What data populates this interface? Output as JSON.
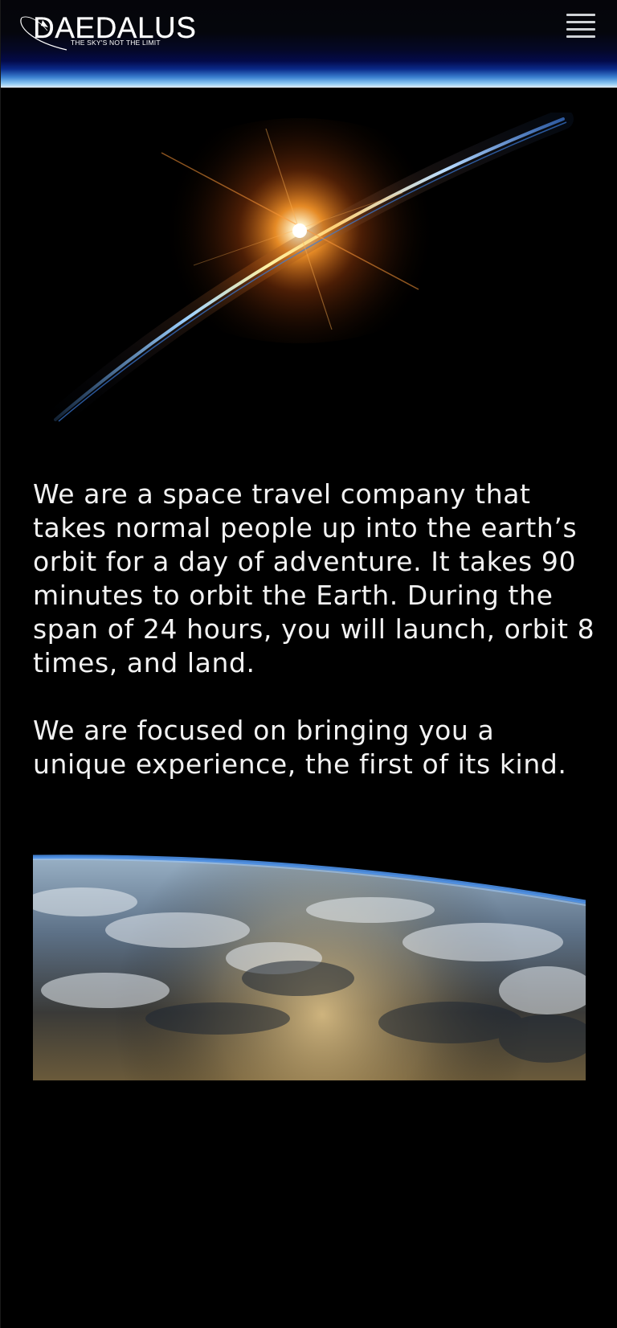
{
  "header": {
    "logo_text": "DAEDALUS",
    "tagline": "THE SKY'S NOT THE LIMIT",
    "menu_icon": "hamburger-menu-icon"
  },
  "hero": {
    "image_subject": "sunrise-over-earth-horizon"
  },
  "intro": {
    "paragraph_1": "We are a space travel company that takes normal people up into the earth’s orbit for a day of adventure. It takes 90 minutes to orbit the Earth. During the span of 24 hours, you will launch, orbit 8 times, and land.",
    "paragraph_2": "We are focused on bringing you a unique experience, the first of its kind."
  },
  "earth": {
    "image_subject": "earth-from-orbit-clouds"
  },
  "colors": {
    "background": "#000000",
    "text": "#f2f2f2",
    "header_glow": "#3a7fd0",
    "sun_glow": "#ff9a2a"
  }
}
